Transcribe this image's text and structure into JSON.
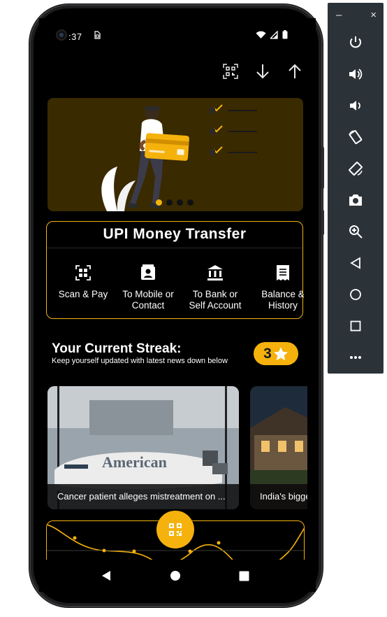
{
  "status_bar": {
    "time": ":37",
    "sim_icon": "sim-card-icon"
  },
  "top_actions": [
    "qr-scan-icon",
    "download-arrow-icon",
    "upload-arrow-icon"
  ],
  "carousel": {
    "page_count": 4,
    "active_index": 0
  },
  "upi": {
    "title": "UPI Money Transfer",
    "items": [
      {
        "label1": "Scan & Pay",
        "label2": "",
        "icon": "qr-scan-icon"
      },
      {
        "label1": "To Mobile or",
        "label2": "Contact",
        "icon": "contact-book-icon"
      },
      {
        "label1": "To Bank or",
        "label2": "Self Account",
        "icon": "bank-icon"
      },
      {
        "label1": "Balance &",
        "label2": "History",
        "icon": "receipt-icon"
      }
    ]
  },
  "streak": {
    "title": "Your Current Streak:",
    "subtitle": "Keep yourself updated with latest news down below",
    "count": "3",
    "badge_icon": "star-icon"
  },
  "news": [
    {
      "caption": "Cancer patient alleges mistreatment on ...",
      "image": "american-airlines-plane"
    },
    {
      "caption": "India's bigge",
      "image": "house-at-dusk"
    }
  ],
  "fab": {
    "icon": "qr-code-icon"
  },
  "nav": [
    "back-icon",
    "home-icon",
    "recents-icon"
  ],
  "emulator": {
    "window_controls": {
      "minimize": "–",
      "close": "×"
    },
    "tools": [
      "power-icon",
      "volume-up-icon",
      "volume-down-icon",
      "rotate-left-icon",
      "rotate-right-icon",
      "camera-icon",
      "zoom-icon",
      "back-icon",
      "home-icon",
      "overview-icon",
      "more-icon"
    ]
  },
  "colors": {
    "accent": "#f5b20d",
    "background": "#000000",
    "banner": "#3a2a00",
    "emulator_panel": "#2b3338"
  }
}
